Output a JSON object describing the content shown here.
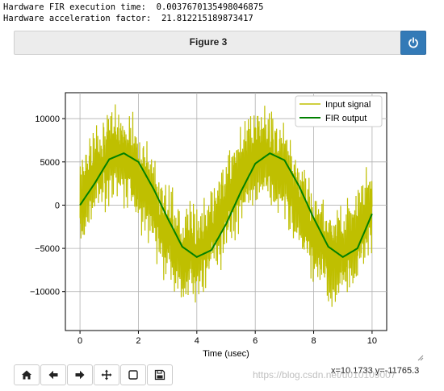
{
  "output": {
    "line1": "Hardware FIR execution time:  0.0037670135498046875",
    "line2": "Hardware acceleration factor:  21.812215189873417"
  },
  "figure": {
    "title": "Figure 3",
    "coordinates": "x=10.1733 y=-11765.3",
    "watermark": "https://blog.csdn.net/u010109007"
  },
  "toolbar": {
    "buttons": [
      "home-icon",
      "back-arrow-icon",
      "forward-arrow-icon",
      "pan-icon",
      "zoom-rect-icon",
      "save-icon"
    ]
  },
  "colors": {
    "input_signal": "#bfbf00",
    "fir_output": "#008000",
    "power_button": "#337ab7"
  },
  "chart_data": {
    "type": "line",
    "xlabel": "Time (usec)",
    "x_ticks": [
      "0",
      "2",
      "4",
      "6",
      "8",
      "10"
    ],
    "y_ticks": [
      "−10000",
      "−5000",
      "0",
      "5000",
      "10000"
    ],
    "xlim": [
      -0.5,
      10.5
    ],
    "ylim": [
      -14500,
      13000
    ],
    "grid": true,
    "legend_position": "top-right",
    "series": [
      {
        "name": "Input signal",
        "description_values": "sine of amplitude ~6000, period ~5 usec, plus high-frequency noise of amplitude ~6000",
        "x": [
          0,
          0.5,
          1,
          1.5,
          2,
          2.5,
          3,
          3.5,
          4,
          4.5,
          5,
          5.5,
          6,
          6.5,
          7,
          7.5,
          8,
          8.5,
          9,
          9.5,
          10
        ],
        "values": [
          0,
          3700,
          5700,
          5700,
          3500,
          0,
          -3500,
          -5700,
          -5700,
          -3500,
          0,
          3500,
          5700,
          5700,
          3500,
          0,
          -3500,
          -5700,
          -5700,
          -3500,
          0
        ],
        "noise_amplitude": 6000
      },
      {
        "name": "FIR output",
        "x": [
          0,
          0.5,
          1,
          1.5,
          2,
          2.5,
          3,
          3.5,
          4,
          4.5,
          5,
          5.5,
          6,
          6.5,
          7,
          7.5,
          8,
          8.5,
          9,
          9.5,
          10
        ],
        "values": [
          0,
          2500,
          5300,
          6000,
          5000,
          2000,
          -1500,
          -4800,
          -6000,
          -5200,
          -2200,
          1500,
          4800,
          6000,
          5200,
          2200,
          -1500,
          -4800,
          -6000,
          -5000,
          -1000
        ]
      }
    ]
  }
}
